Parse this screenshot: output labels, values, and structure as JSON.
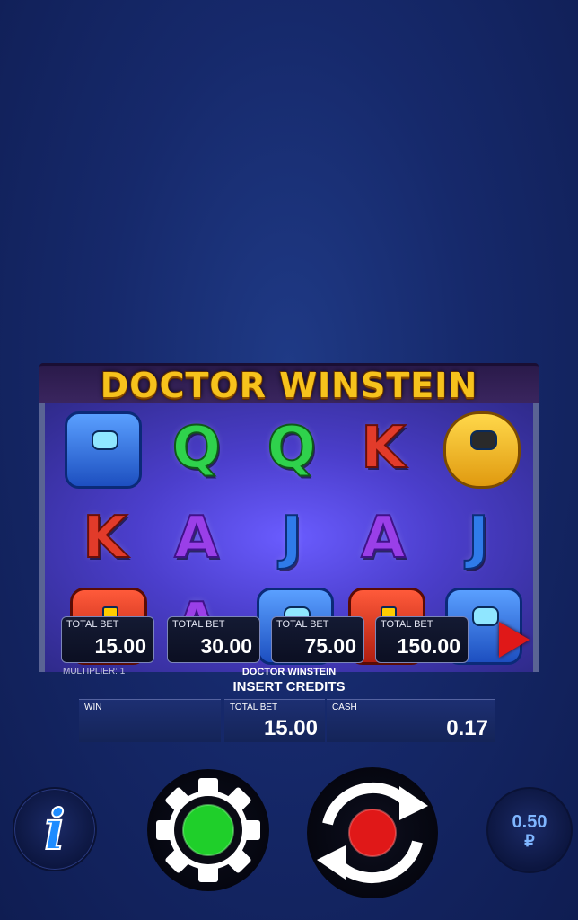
{
  "game": {
    "title": "DOCTOR WINSTEIN",
    "name_label": "DOCTOR WINSTEIN",
    "status": "INSERT CREDITS",
    "multiplier": "MULTIPLIER: 1"
  },
  "reels": [
    [
      "robot-blue",
      "Q",
      "Q",
      "K",
      "robot-yellow"
    ],
    [
      "K",
      "A",
      "J",
      "A",
      "J"
    ],
    [
      "robot-red",
      "A",
      "robot-blue",
      "robot-red",
      "robot-blue"
    ]
  ],
  "bet_options": [
    {
      "label": "TOTAL BET",
      "value": "15.00"
    },
    {
      "label": "TOTAL BET",
      "value": "30.00"
    },
    {
      "label": "TOTAL BET",
      "value": "75.00"
    },
    {
      "label": "TOTAL BET",
      "value": "150.00"
    }
  ],
  "info_bar": {
    "win": {
      "label": "WIN",
      "value": ""
    },
    "total_bet": {
      "label": "TOTAL BET",
      "value": "15.00"
    },
    "cash": {
      "label": "CASH",
      "value": "0.17"
    }
  },
  "controls": {
    "info_icon": "info-icon",
    "settings_icon": "gear-icon",
    "spin_icon": "spin-arrows-icon",
    "coin_value": "0.50",
    "currency": "₽"
  },
  "colors": {
    "background": "#16296b",
    "title_gold": "#f6c21c",
    "play_red": "#e01818",
    "settings_green": "#1fcf2a",
    "spin_red": "#e01818",
    "info_blue": "#1e8cff"
  }
}
